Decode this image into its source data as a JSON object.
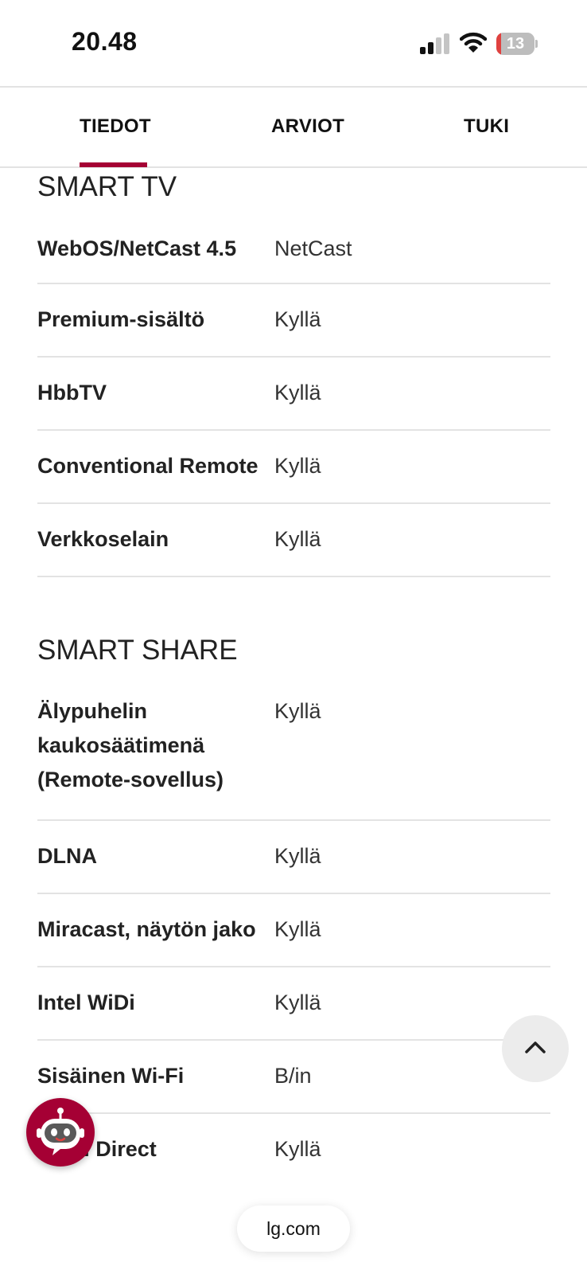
{
  "status_bar": {
    "time": "20.48",
    "battery_level": "13",
    "battery_fraction": 0.13,
    "icons": [
      "signal-icon",
      "wifi-icon",
      "battery-icon"
    ]
  },
  "tabs": [
    {
      "label": "TIEDOT",
      "active": true
    },
    {
      "label": "ARVIOT",
      "active": false
    },
    {
      "label": "TUKI",
      "active": false
    }
  ],
  "sections": [
    {
      "title": "SMART TV",
      "rows": [
        {
          "label": "WebOS/NetCast 4.5",
          "value": "NetCast"
        },
        {
          "label": "Premium-sisältö",
          "value": "Kyllä"
        },
        {
          "label": "HbbTV",
          "value": "Kyllä"
        },
        {
          "label": "Conventional Remote",
          "value": "Kyllä"
        },
        {
          "label": "Verkkoselain",
          "value": "Kyllä"
        }
      ]
    },
    {
      "title": "SMART SHARE",
      "rows": [
        {
          "label": "Älypuhelin kaukosäätimenä (Remote-sovellus)",
          "value": "Kyllä"
        },
        {
          "label": "DLNA",
          "value": "Kyllä"
        },
        {
          "label": "Miracast, näytön jako",
          "value": "Kyllä"
        },
        {
          "label": "Intel WiDi",
          "value": "Kyllä"
        },
        {
          "label": "Sisäinen Wi-Fi",
          "value": "B/in"
        },
        {
          "label": "Wi-Fi Direct",
          "value": "Kyllä"
        }
      ]
    }
  ],
  "buttons": {
    "scroll_top_icon": "chevron-up-icon",
    "chatbot_icon": "chatbot-icon"
  },
  "browser": {
    "url": "lg.com"
  },
  "colors": {
    "accent": "#a50034",
    "divider": "#e3e3e3",
    "battery_low": "#e0413f"
  }
}
